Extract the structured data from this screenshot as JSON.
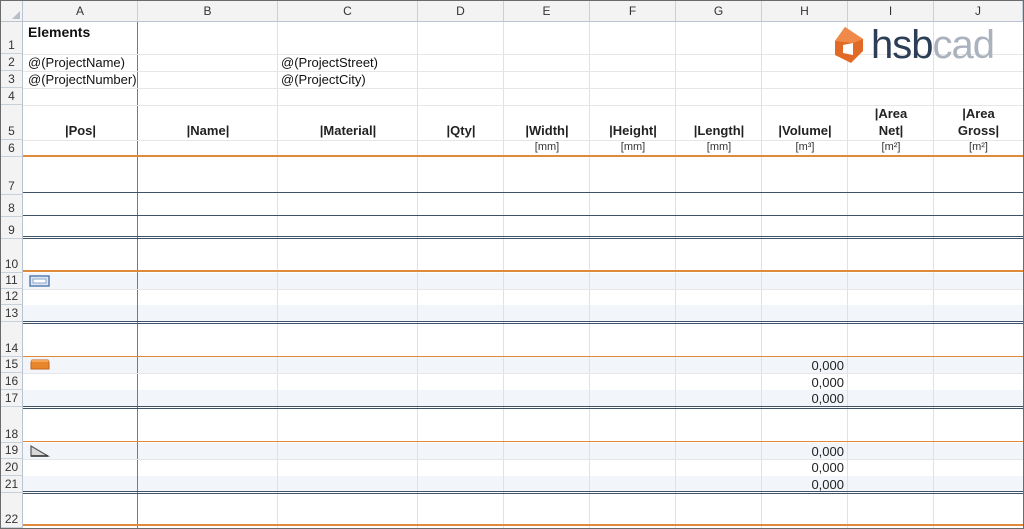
{
  "columns": [
    "A",
    "B",
    "C",
    "D",
    "E",
    "F",
    "G",
    "H",
    "I",
    "J"
  ],
  "rows": [
    "1",
    "2",
    "3",
    "4",
    "5",
    "6",
    "7",
    "8",
    "9",
    "10",
    "11",
    "12",
    "13",
    "14",
    "15",
    "16",
    "17",
    "18",
    "19",
    "20",
    "21",
    "22"
  ],
  "title": "Elements",
  "project": {
    "name": "@(ProjectName)",
    "number": "@(ProjectNumber)",
    "street": "@(ProjectStreet)",
    "city": "@(ProjectCity)"
  },
  "headers": {
    "pos": "|Pos|",
    "name": "|Name|",
    "material": "|Material|",
    "qty": "|Qty|",
    "width": "|Width|",
    "height": "|Height|",
    "length": "|Length|",
    "volume": "|Volume|",
    "area_net_1": "|Area",
    "area_net_2": "Net|",
    "area_gross_1": "|Area",
    "area_gross_2": "Gross|"
  },
  "units": {
    "width": "[mm]",
    "height": "[mm]",
    "length": "[mm]",
    "volume": "[m³]",
    "area_net": "[m²]",
    "area_gross": "[m²]"
  },
  "volume_values": [
    "0,000",
    "0,000",
    "0,000",
    "0,000",
    "0,000",
    "0,000"
  ],
  "logo": {
    "part1": "hsb",
    "part2": "cad",
    "accent_color": "#e06a26"
  },
  "icons": [
    "wall-element-icon",
    "beam-element-icon",
    "roof-element-icon"
  ]
}
